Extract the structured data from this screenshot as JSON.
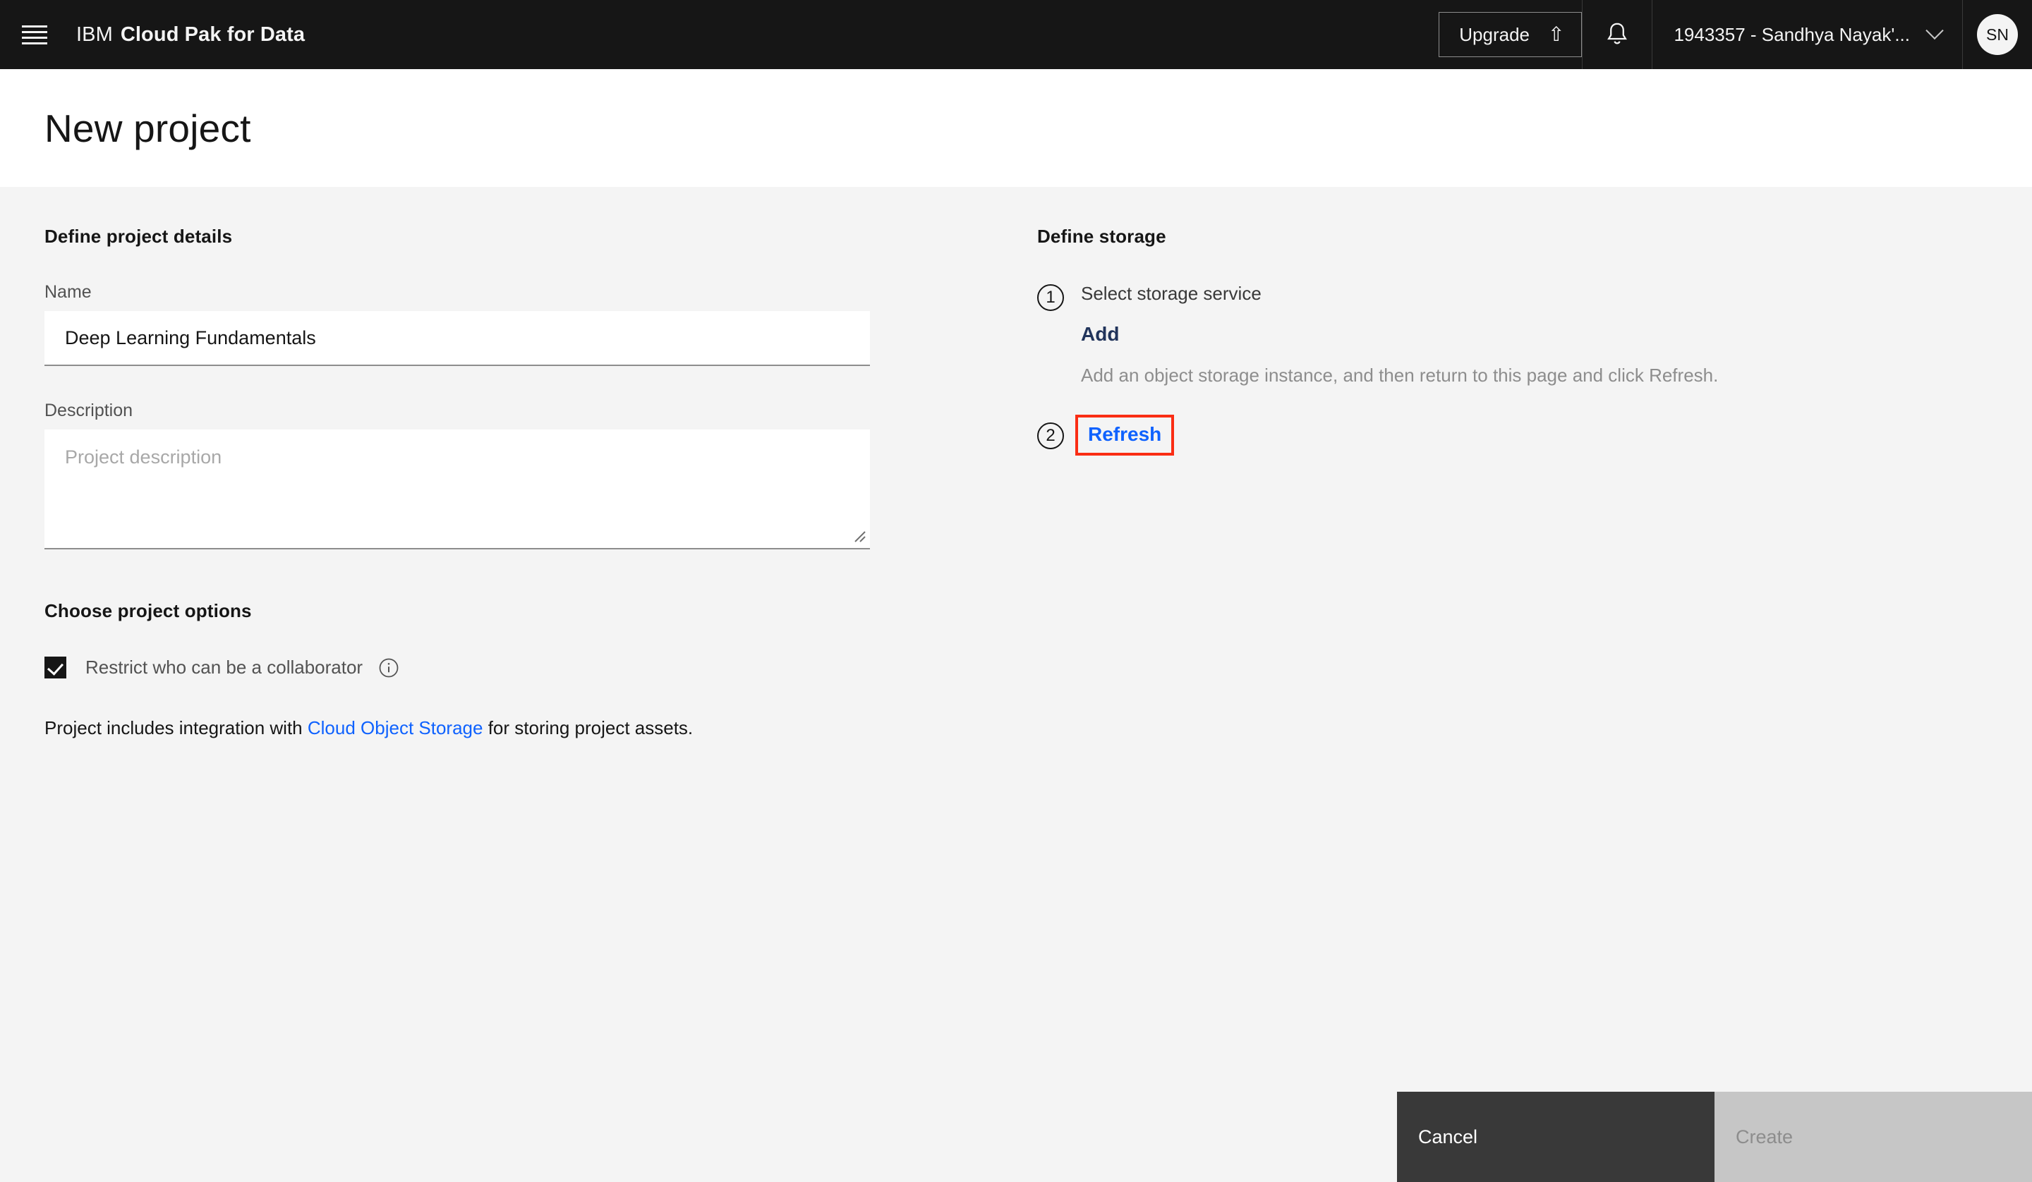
{
  "header": {
    "menu_icon": "hamburger-menu-icon",
    "brand_prefix": "IBM",
    "brand_product": "Cloud Pak for Data",
    "upgrade_label": "Upgrade",
    "upgrade_icon": "arrow-up-icon",
    "notifications_icon": "bell-icon",
    "account_label": "1943357 - Sandhya Nayak'...",
    "account_chevron_icon": "chevron-down-icon",
    "avatar_initials": "SN"
  },
  "page": {
    "title": "New project"
  },
  "project_details": {
    "section_title": "Define project details",
    "name_label": "Name",
    "name_value": "Deep Learning Fundamentals",
    "description_label": "Description",
    "description_value": "",
    "description_placeholder": "Project description"
  },
  "project_options": {
    "section_title": "Choose project options",
    "restrict_checkbox_label": "Restrict who can be a collaborator",
    "restrict_checkbox_checked": true,
    "info_icon": "information-icon",
    "integration_text_before": "Project includes integration with ",
    "integration_link": "Cloud Object Storage",
    "integration_text_after": " for storing project assets."
  },
  "storage": {
    "section_title": "Define storage",
    "step_one_number": "1",
    "step_one_title": "Select storage service",
    "add_link_label": "Add",
    "help_text": "Add an object storage instance, and then return to this page and click Refresh.",
    "step_two_number": "2",
    "refresh_link_label": "Refresh"
  },
  "actions": {
    "cancel_label": "Cancel",
    "create_label": "Create"
  },
  "colors": {
    "header_background": "#161616",
    "content_background": "#f4f4f4",
    "link_blue": "#0f62fe",
    "add_link_navy": "#21345b",
    "highlight_red": "#fa2d14",
    "cancel_button": "#393939",
    "create_button_disabled": "#c6c6c6"
  }
}
